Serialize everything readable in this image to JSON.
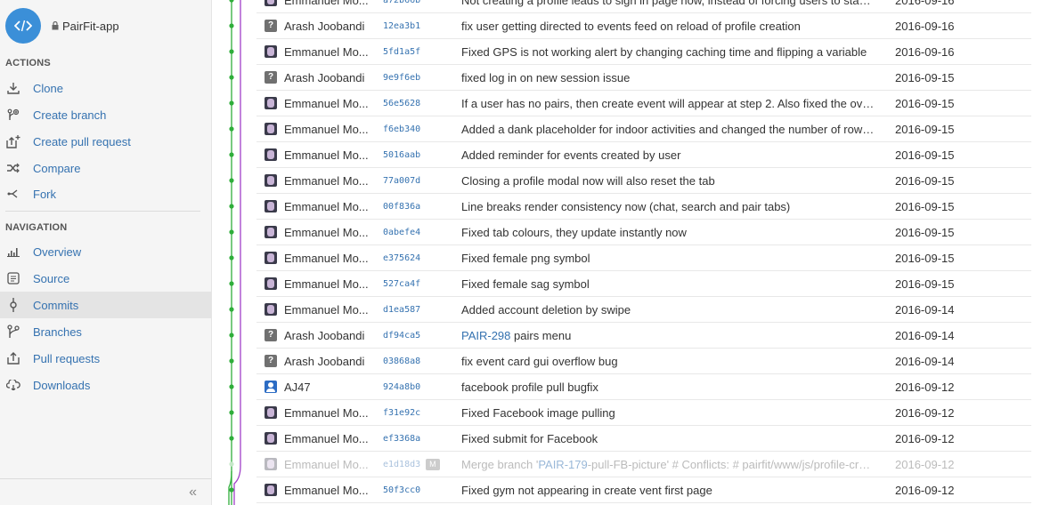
{
  "repo": {
    "name": "PairFit-app"
  },
  "sidebar": {
    "actions_title": "ACTIONS",
    "actions": [
      {
        "label": "Clone",
        "icon": "download-icon"
      },
      {
        "label": "Create branch",
        "icon": "create-branch-icon"
      },
      {
        "label": "Create pull request",
        "icon": "create-pull-request-icon"
      },
      {
        "label": "Compare",
        "icon": "compare-icon"
      },
      {
        "label": "Fork",
        "icon": "fork-icon"
      }
    ],
    "navigation_title": "NAVIGATION",
    "navigation": [
      {
        "label": "Overview",
        "icon": "overview-icon"
      },
      {
        "label": "Source",
        "icon": "source-icon"
      },
      {
        "label": "Commits",
        "icon": "commits-icon",
        "active": true
      },
      {
        "label": "Branches",
        "icon": "branches-icon"
      },
      {
        "label": "Pull requests",
        "icon": "pull-requests-icon"
      },
      {
        "label": "Downloads",
        "icon": "downloads-icon"
      }
    ],
    "collapse_label": "«"
  },
  "commits": [
    {
      "author": "Emmanuel Mo...",
      "avatar": "e",
      "hash": "a72b66b",
      "message": "Not creating a profile leads to sign in page now, instead of forcing users to stay in...",
      "date": "2016-09-16"
    },
    {
      "author": "Arash Joobandi",
      "avatar": "q",
      "hash": "12ea3b1",
      "message": "fix user getting directed to events feed on reload of profile creation",
      "date": "2016-09-16"
    },
    {
      "author": "Emmanuel Mo...",
      "avatar": "e",
      "hash": "5fd1a5f",
      "message": "Fixed GPS is not working alert by changing caching time and flipping a variable",
      "date": "2016-09-16"
    },
    {
      "author": "Arash Joobandi",
      "avatar": "q",
      "hash": "9e9f6eb",
      "message": "fixed log in on new session issue",
      "date": "2016-09-15"
    },
    {
      "author": "Emmanuel Mo...",
      "avatar": "e",
      "hash": "56e5628",
      "message": "If a user has no pairs, then create event will appear at step 2. Also fixed the overf...",
      "date": "2016-09-15"
    },
    {
      "author": "Emmanuel Mo...",
      "avatar": "e",
      "hash": "f6eb340",
      "message": "Added a dank placeholder for indoor activities and changed the number of rows ...",
      "date": "2016-09-15"
    },
    {
      "author": "Emmanuel Mo...",
      "avatar": "e",
      "hash": "5016aab",
      "message": "Added reminder for events created by user",
      "date": "2016-09-15"
    },
    {
      "author": "Emmanuel Mo...",
      "avatar": "e",
      "hash": "77a007d",
      "message": "Closing a profile modal now will also reset the tab",
      "date": "2016-09-15"
    },
    {
      "author": "Emmanuel Mo...",
      "avatar": "e",
      "hash": "00f836a",
      "message": "Line breaks render consistency now (chat, search and pair tabs)",
      "date": "2016-09-15"
    },
    {
      "author": "Emmanuel Mo...",
      "avatar": "e",
      "hash": "0abefe4",
      "message": "Fixed tab colours, they update instantly now",
      "date": "2016-09-15"
    },
    {
      "author": "Emmanuel Mo...",
      "avatar": "e",
      "hash": "e375624",
      "message": "Fixed female png symbol",
      "date": "2016-09-15"
    },
    {
      "author": "Emmanuel Mo...",
      "avatar": "e",
      "hash": "527ca4f",
      "message": "Fixed female sag symbol",
      "date": "2016-09-15"
    },
    {
      "author": "Emmanuel Mo...",
      "avatar": "e",
      "hash": "d1ea587",
      "message": "Added account deletion by swipe",
      "date": "2016-09-14"
    },
    {
      "author": "Arash Joobandi",
      "avatar": "q",
      "hash": "df94ca5",
      "message_link": "PAIR-298",
      "message": " pairs menu",
      "date": "2016-09-14"
    },
    {
      "author": "Arash Joobandi",
      "avatar": "q",
      "hash": "03868a8",
      "message": "fix event card gui overflow bug",
      "date": "2016-09-14"
    },
    {
      "author": "AJ47",
      "avatar": "a",
      "hash": "924a8b0",
      "message": "facebook profile pull bugfix",
      "date": "2016-09-12"
    },
    {
      "author": "Emmanuel Mo...",
      "avatar": "e",
      "hash": "f31e92c",
      "message": "Fixed Facebook image pulling",
      "date": "2016-09-12"
    },
    {
      "author": "Emmanuel Mo...",
      "avatar": "e",
      "hash": "ef3368a",
      "message": "Fixed submit for Facebook",
      "date": "2016-09-12"
    },
    {
      "author": "Emmanuel Mo...",
      "avatar": "e",
      "hash": "e1d18d3",
      "merge": true,
      "merge_badge": "M",
      "message_prefix": "Merge branch '",
      "message_link": "PAIR-179",
      "message": "-pull-FB-picture' # Conflicts: # pairfit/www/js/profile-creati...",
      "date": "2016-09-12"
    },
    {
      "author": "Emmanuel Mo...",
      "avatar": "e",
      "hash": "50f3cc0",
      "message": "Fixed gym not appearing in create vent first page",
      "date": "2016-09-12"
    }
  ]
}
